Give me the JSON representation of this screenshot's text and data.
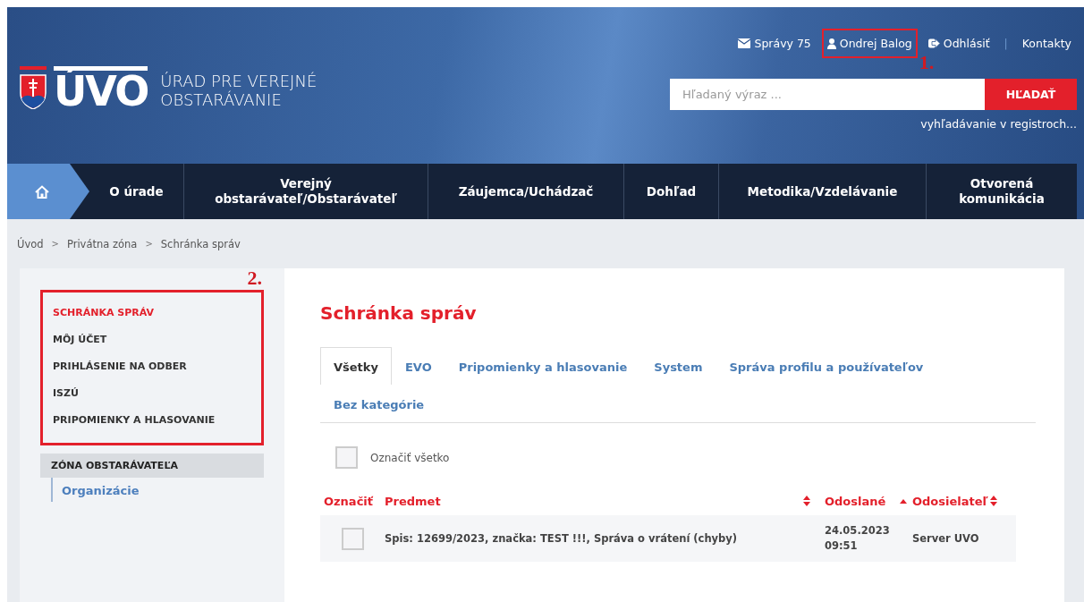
{
  "header": {
    "logo": {
      "letters": "ÚVO",
      "name_lines": [
        "ÚRAD PRE VEREJNÉ",
        "OBSTARÁVANIE"
      ]
    },
    "top_links": [
      {
        "kind": "messages",
        "label": "Správy 75",
        "highlighted": false
      },
      {
        "kind": "user",
        "label": "Ondrej Balog",
        "highlighted": true
      },
      {
        "kind": "logout",
        "label": "Odhlásiť",
        "highlighted": false
      },
      {
        "kind": "plain",
        "label": "Kontakty",
        "highlighted": false
      }
    ],
    "link_separator": "|",
    "annotation": "1.",
    "search": {
      "placeholder": "Hľadaný výraz ...",
      "button": "HĽADAŤ",
      "registry_link": "vyhľadávanie v registroch..."
    }
  },
  "nav": [
    {
      "kind": "home",
      "selected": true
    },
    {
      "kind": "link",
      "label": "O úrade",
      "selected": false
    },
    {
      "kind": "link",
      "label": "Verejný obstarávateľ/Obstarávateľ",
      "selected": false
    },
    {
      "kind": "link",
      "label": "Záujemca/Uchádzač",
      "selected": false
    },
    {
      "kind": "link",
      "label": "Dohľad",
      "selected": false
    },
    {
      "kind": "link",
      "label": "Metodika/Vzdelávanie",
      "selected": false
    },
    {
      "kind": "link",
      "label": "Otvorená komunikácia",
      "selected": false
    }
  ],
  "breadcrumb": {
    "separator": ">",
    "items": [
      "Úvod",
      "Privátna zóna",
      "Schránka správ"
    ]
  },
  "sidebar": {
    "annotation": "2.",
    "highlighted": true,
    "items": [
      {
        "label": "SCHRÁNKA SPRÁV",
        "selected": true
      },
      {
        "label": "MÔJ ÚČET",
        "selected": false
      },
      {
        "label": "PRIHLÁSENIE NA ODBER",
        "selected": false
      },
      {
        "label": "ISZÚ",
        "selected": false
      },
      {
        "label": "PRIPOMIENKY A HLASOVANIE",
        "selected": false
      }
    ],
    "section": {
      "label": "ZÓNA OBSTARÁVATEĽA",
      "children": [
        {
          "label": "Organizácie"
        }
      ]
    }
  },
  "main": {
    "title": "Schránka správ",
    "tabs": [
      {
        "label": "Všetky",
        "selected": true
      },
      {
        "label": "EVO",
        "selected": false
      },
      {
        "label": "Pripomienky a hlasovanie",
        "selected": false
      },
      {
        "label": "System",
        "selected": false
      },
      {
        "label": "Správa profilu a používateľov",
        "selected": false
      },
      {
        "label": "Bez kategórie",
        "selected": false
      }
    ],
    "select_all": {
      "label": "Označiť všetko",
      "checked": false
    },
    "table": {
      "columns": [
        {
          "label": "Označiť",
          "sortable": false
        },
        {
          "label": "Predmet",
          "sortable": true,
          "sorted_ascending": false
        },
        {
          "label": "Odoslané",
          "sortable": true,
          "sorted_ascending": true
        },
        {
          "label": "Odosielateľ",
          "sortable": true,
          "sorted_ascending": false
        }
      ],
      "rows": [
        {
          "checked": false,
          "subject": "Spis: 12699/2023, značka: TEST !!!, Správa o vrátení (chyby)",
          "sent_date": "24.05.2023",
          "sent_time": "09:51",
          "sender": "Server UVO"
        }
      ]
    }
  }
}
